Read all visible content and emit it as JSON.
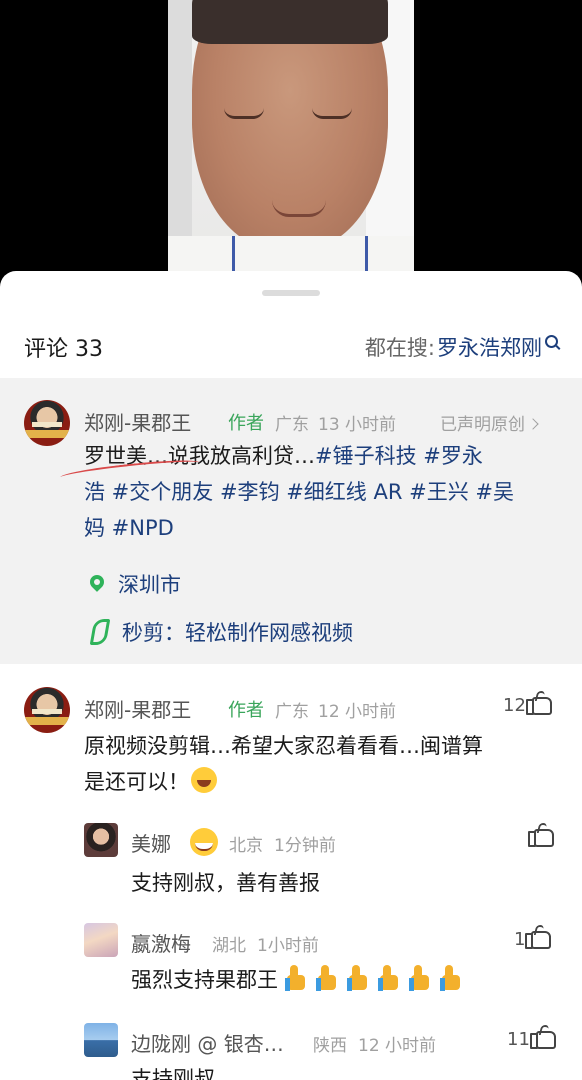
{
  "video": {
    "description_hidden": ""
  },
  "header": {
    "comments_label": "评论 33",
    "search_prefix": "都在搜:",
    "search_keyword": "罗永浩郑刚"
  },
  "post": {
    "author": "郑刚-果郡王",
    "author_tag": "作者",
    "region": "广东",
    "time": "13 小时前",
    "original_claim": "已声明原创",
    "text_lead": "罗世美…说我放高利贷…",
    "tags": [
      "#锤子科技",
      "#罗永浩",
      "#交个朋友",
      "#李钧",
      "#细红线 AR",
      "#王兴",
      "#吴妈",
      "#NPD"
    ],
    "line1_tail": "#锤子科技 #罗永",
    "line2": "浩 #交个朋友 #李钧 #细红线 AR #王兴 #吴",
    "line3": "妈 #NPD",
    "location": "深圳市",
    "app_promo": "秒剪：轻松制作网感视频"
  },
  "comments": [
    {
      "name": "郑刚-果郡王",
      "author_tag": "作者",
      "region": "广东",
      "time": "12 小时前",
      "likes": "12",
      "line1": "原视频没剪辑…希望大家忍着看看…闽谱算",
      "line2": "是还可以！",
      "emoji": "laugh-cry-emoji"
    },
    {
      "name": "美娜",
      "region": "北京",
      "time": "1分钟前",
      "likes": "",
      "text": "支持刚叔，善有善报",
      "emoji": "grin-emoji"
    },
    {
      "name": "嬴激梅",
      "region": "湖北",
      "time": "1小时前",
      "likes": "1",
      "text": "强烈支持果郡王",
      "emoji_count": 6
    },
    {
      "name": "边陇刚 @ 银杏…",
      "region": "陕西",
      "time": "12 小时前",
      "likes": "11",
      "text": "支持刚叔"
    }
  ],
  "colors": {
    "tag_blue": "#1d3f7c",
    "author_green": "#3aa55b",
    "meta_gray": "#a0a0a0",
    "post_bg": "#f2f2f2"
  }
}
